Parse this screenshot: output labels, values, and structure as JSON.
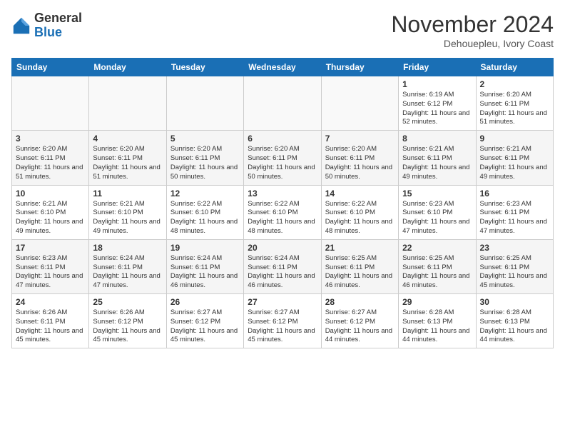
{
  "header": {
    "logo_line1": "General",
    "logo_line2": "Blue",
    "month": "November 2024",
    "location": "Dehouepleu, Ivory Coast"
  },
  "weekdays": [
    "Sunday",
    "Monday",
    "Tuesday",
    "Wednesday",
    "Thursday",
    "Friday",
    "Saturday"
  ],
  "weeks": [
    [
      {
        "day": "",
        "text": ""
      },
      {
        "day": "",
        "text": ""
      },
      {
        "day": "",
        "text": ""
      },
      {
        "day": "",
        "text": ""
      },
      {
        "day": "",
        "text": ""
      },
      {
        "day": "1",
        "text": "Sunrise: 6:19 AM\nSunset: 6:12 PM\nDaylight: 11 hours and 52 minutes."
      },
      {
        "day": "2",
        "text": "Sunrise: 6:20 AM\nSunset: 6:11 PM\nDaylight: 11 hours and 51 minutes."
      }
    ],
    [
      {
        "day": "3",
        "text": "Sunrise: 6:20 AM\nSunset: 6:11 PM\nDaylight: 11 hours and 51 minutes."
      },
      {
        "day": "4",
        "text": "Sunrise: 6:20 AM\nSunset: 6:11 PM\nDaylight: 11 hours and 51 minutes."
      },
      {
        "day": "5",
        "text": "Sunrise: 6:20 AM\nSunset: 6:11 PM\nDaylight: 11 hours and 50 minutes."
      },
      {
        "day": "6",
        "text": "Sunrise: 6:20 AM\nSunset: 6:11 PM\nDaylight: 11 hours and 50 minutes."
      },
      {
        "day": "7",
        "text": "Sunrise: 6:20 AM\nSunset: 6:11 PM\nDaylight: 11 hours and 50 minutes."
      },
      {
        "day": "8",
        "text": "Sunrise: 6:21 AM\nSunset: 6:11 PM\nDaylight: 11 hours and 49 minutes."
      },
      {
        "day": "9",
        "text": "Sunrise: 6:21 AM\nSunset: 6:11 PM\nDaylight: 11 hours and 49 minutes."
      }
    ],
    [
      {
        "day": "10",
        "text": "Sunrise: 6:21 AM\nSunset: 6:10 PM\nDaylight: 11 hours and 49 minutes."
      },
      {
        "day": "11",
        "text": "Sunrise: 6:21 AM\nSunset: 6:10 PM\nDaylight: 11 hours and 49 minutes."
      },
      {
        "day": "12",
        "text": "Sunrise: 6:22 AM\nSunset: 6:10 PM\nDaylight: 11 hours and 48 minutes."
      },
      {
        "day": "13",
        "text": "Sunrise: 6:22 AM\nSunset: 6:10 PM\nDaylight: 11 hours and 48 minutes."
      },
      {
        "day": "14",
        "text": "Sunrise: 6:22 AM\nSunset: 6:10 PM\nDaylight: 11 hours and 48 minutes."
      },
      {
        "day": "15",
        "text": "Sunrise: 6:23 AM\nSunset: 6:10 PM\nDaylight: 11 hours and 47 minutes."
      },
      {
        "day": "16",
        "text": "Sunrise: 6:23 AM\nSunset: 6:11 PM\nDaylight: 11 hours and 47 minutes."
      }
    ],
    [
      {
        "day": "17",
        "text": "Sunrise: 6:23 AM\nSunset: 6:11 PM\nDaylight: 11 hours and 47 minutes."
      },
      {
        "day": "18",
        "text": "Sunrise: 6:24 AM\nSunset: 6:11 PM\nDaylight: 11 hours and 47 minutes."
      },
      {
        "day": "19",
        "text": "Sunrise: 6:24 AM\nSunset: 6:11 PM\nDaylight: 11 hours and 46 minutes."
      },
      {
        "day": "20",
        "text": "Sunrise: 6:24 AM\nSunset: 6:11 PM\nDaylight: 11 hours and 46 minutes."
      },
      {
        "day": "21",
        "text": "Sunrise: 6:25 AM\nSunset: 6:11 PM\nDaylight: 11 hours and 46 minutes."
      },
      {
        "day": "22",
        "text": "Sunrise: 6:25 AM\nSunset: 6:11 PM\nDaylight: 11 hours and 46 minutes."
      },
      {
        "day": "23",
        "text": "Sunrise: 6:25 AM\nSunset: 6:11 PM\nDaylight: 11 hours and 45 minutes."
      }
    ],
    [
      {
        "day": "24",
        "text": "Sunrise: 6:26 AM\nSunset: 6:11 PM\nDaylight: 11 hours and 45 minutes."
      },
      {
        "day": "25",
        "text": "Sunrise: 6:26 AM\nSunset: 6:12 PM\nDaylight: 11 hours and 45 minutes."
      },
      {
        "day": "26",
        "text": "Sunrise: 6:27 AM\nSunset: 6:12 PM\nDaylight: 11 hours and 45 minutes."
      },
      {
        "day": "27",
        "text": "Sunrise: 6:27 AM\nSunset: 6:12 PM\nDaylight: 11 hours and 45 minutes."
      },
      {
        "day": "28",
        "text": "Sunrise: 6:27 AM\nSunset: 6:12 PM\nDaylight: 11 hours and 44 minutes."
      },
      {
        "day": "29",
        "text": "Sunrise: 6:28 AM\nSunset: 6:13 PM\nDaylight: 11 hours and 44 minutes."
      },
      {
        "day": "30",
        "text": "Sunrise: 6:28 AM\nSunset: 6:13 PM\nDaylight: 11 hours and 44 minutes."
      }
    ]
  ]
}
